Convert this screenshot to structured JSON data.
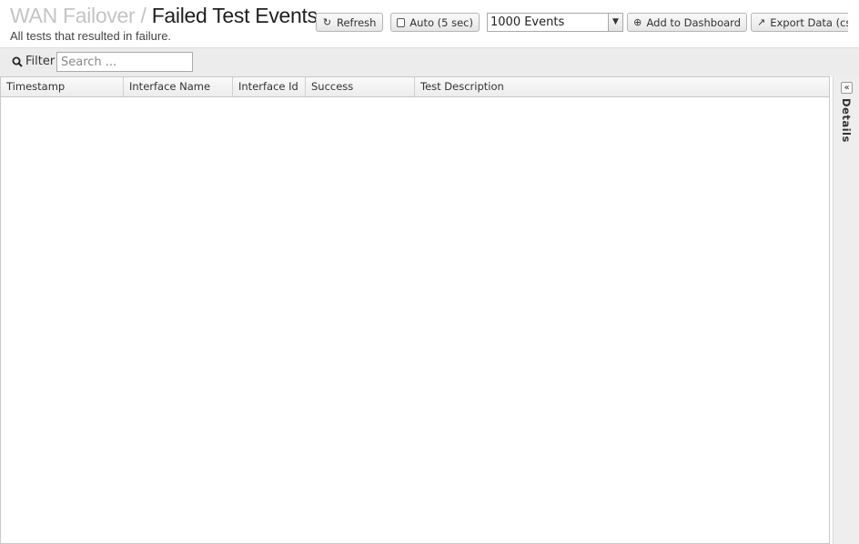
{
  "header": {
    "breadcrumb": "WAN Failover",
    "separator": "/",
    "title": "Failed Test Events",
    "subtitle": "All tests that resulted in failure."
  },
  "toolbar": {
    "refresh_label": "Refresh",
    "auto_label": "Auto (5 sec)",
    "events_selected": "1000 Events",
    "add_dashboard_label": "Add to Dashboard",
    "export_label": "Export Data (csv)"
  },
  "filter": {
    "label": "Filter",
    "placeholder": "Search ..."
  },
  "grid": {
    "columns": [
      "Timestamp",
      "Interface Name",
      "Interface Id",
      "Success",
      "Test Description"
    ],
    "rows": []
  },
  "details_panel": {
    "label": "Details"
  },
  "icons": {
    "refresh": "refresh-icon",
    "checkbox": "checkbox-icon",
    "add": "plus-circle-icon",
    "export": "export-icon",
    "search": "search-icon",
    "collapse": "double-chevron-left-icon"
  }
}
